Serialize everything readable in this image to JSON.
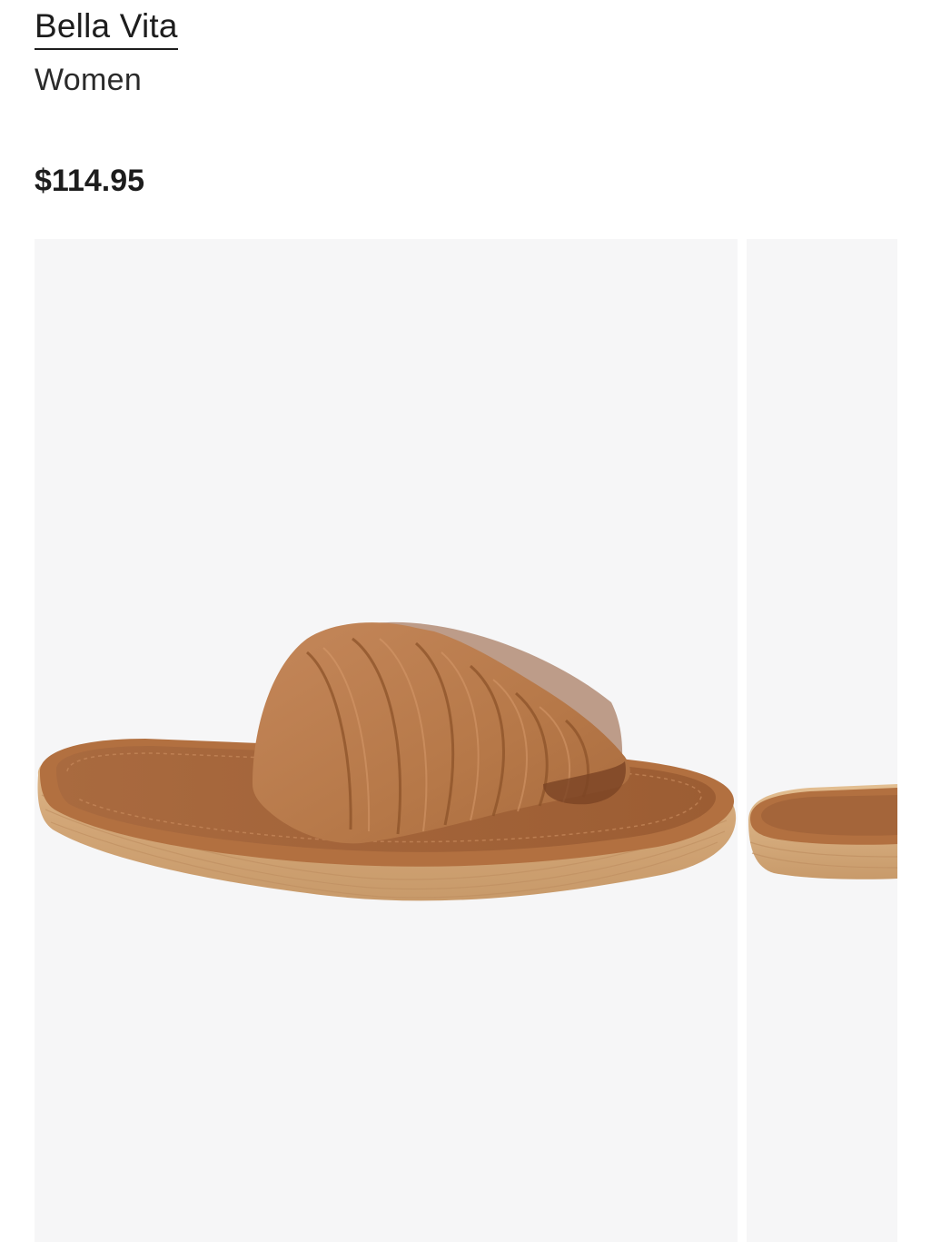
{
  "product": {
    "brand": "Bella Vita",
    "category": "Women",
    "price": "$114.95"
  },
  "gallery": {
    "images": [
      {
        "alt": "Tan leather slide sandal, side view",
        "icon": "sandal-image"
      },
      {
        "alt": "Tan leather slide sandal, partial view",
        "icon": "sandal-image"
      }
    ]
  },
  "colors": {
    "text": "#1d1d1d",
    "image_background": "#f6f6f7",
    "leather": "#b87a4b",
    "footbed": "#a4653a",
    "sole": "#d8b182"
  }
}
